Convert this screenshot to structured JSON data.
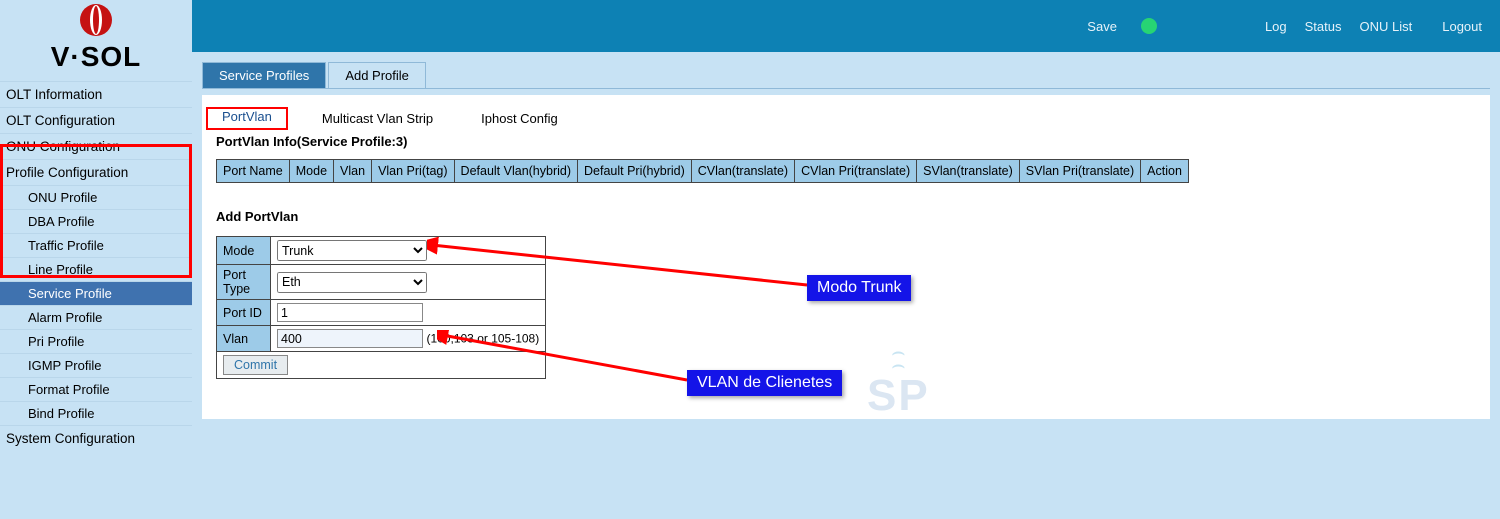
{
  "brand": {
    "name": "V·SOL"
  },
  "topbar": {
    "save": "Save",
    "log": "Log",
    "status": "Status",
    "onu_list": "ONU List",
    "logout": "Logout"
  },
  "sidebar": {
    "groups": [
      {
        "title": "OLT Information"
      },
      {
        "title": "OLT Configuration"
      },
      {
        "title": "ONU Configuration"
      },
      {
        "title": "Profile Configuration",
        "subs": [
          "ONU Profile",
          "DBA Profile",
          "Traffic Profile",
          "Line Profile",
          "Service Profile",
          "Alarm Profile",
          "Pri Profile",
          "IGMP Profile",
          "Format Profile",
          "Bind Profile"
        ],
        "active_sub_index": 4
      },
      {
        "title": "System Configuration"
      }
    ]
  },
  "tabs_primary": {
    "items": [
      "Service Profiles",
      "Add Profile"
    ],
    "active_index": 0
  },
  "tabs_secondary": {
    "items": [
      "PortVlan",
      "Multicast Vlan Strip",
      "Iphost Config"
    ],
    "active_index": 0
  },
  "portvlan_info": {
    "title": "PortVlan Info(Service Profile:3)",
    "headers": [
      "Port Name",
      "Mode",
      "Vlan",
      "Vlan Pri(tag)",
      "Default Vlan(hybrid)",
      "Default Pri(hybrid)",
      "CVlan(translate)",
      "CVlan Pri(translate)",
      "SVlan(translate)",
      "SVlan Pri(translate)",
      "Action"
    ]
  },
  "add_portvlan": {
    "title": "Add PortVlan",
    "rows": {
      "mode": {
        "label": "Mode",
        "value": "Trunk",
        "options": [
          "Trunk"
        ]
      },
      "port_type": {
        "label": "Port Type",
        "value": "Eth",
        "options": [
          "Eth"
        ]
      },
      "port_id": {
        "label": "Port ID",
        "value": "1"
      },
      "vlan": {
        "label": "Vlan",
        "value": "400",
        "hint": "(100,103 or 105-108)"
      }
    },
    "commit": "Commit"
  },
  "annotations": {
    "modo_trunk": "Modo Trunk",
    "vlan_clientes": "VLAN de Clienetes"
  },
  "watermark": {
    "letters": "SP"
  }
}
